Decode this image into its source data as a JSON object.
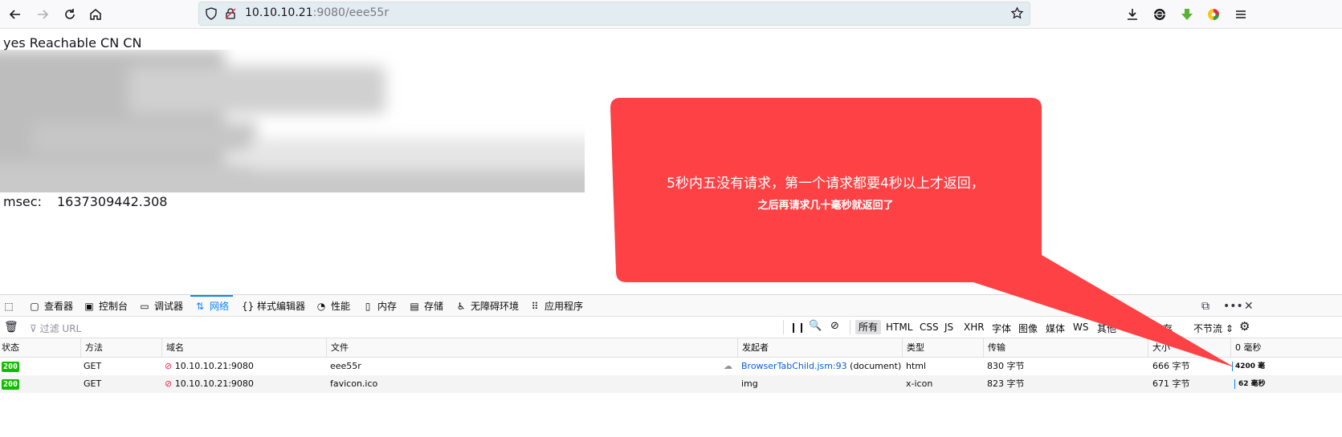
{
  "browser": {
    "url_host": "10.10.10.21",
    "url_rest": ":9080/eee55r"
  },
  "page": {
    "line1": "yes Reachable CN CN",
    "msec_label": "msec:",
    "msec_value": "1637309442.308"
  },
  "callout": {
    "line1": "5秒内五没有请求，第一个请求都要4秒以上才返回，",
    "line2": "之后再请求几十毫秒就返回了",
    "color": "#fe4145"
  },
  "devtools": {
    "tabs": [
      {
        "label": "查看器",
        "icon": "inspector-icon"
      },
      {
        "label": "控制台",
        "icon": "console-icon"
      },
      {
        "label": "调试器",
        "icon": "debugger-icon"
      },
      {
        "label": "网络",
        "icon": "network-icon"
      },
      {
        "label": "样式编辑器",
        "icon": "style-editor-icon"
      },
      {
        "label": "性能",
        "icon": "performance-icon"
      },
      {
        "label": "内存",
        "icon": "memory-icon"
      },
      {
        "label": "存储",
        "icon": "storage-icon"
      },
      {
        "label": "无障碍环境",
        "icon": "accessibility-icon"
      },
      {
        "label": "应用程序",
        "icon": "application-icon"
      }
    ],
    "active_tab": "网络",
    "filter_placeholder": "过滤 URL",
    "type_filters": [
      "所有",
      "HTML",
      "CSS",
      "JS",
      "XHR",
      "字体",
      "图像",
      "媒体",
      "WS",
      "其他"
    ],
    "selected_type": "所有",
    "partial_disable_cache": "存",
    "throttle_label": "不节流",
    "columns": [
      "状态",
      "方法",
      "域名",
      "文件",
      "发起者",
      "类型",
      "传输",
      "大小",
      "0 毫秒"
    ],
    "rows": [
      {
        "status": "200",
        "method": "GET",
        "domain": "10.10.10.21:9080",
        "file": "eee55r",
        "initiator_link": "BrowserTabChild.jsm:93",
        "initiator_rest": " (document)",
        "type": "html",
        "transferred": "830 字节",
        "size": "666 字节",
        "timing": "4200 毫"
      },
      {
        "status": "200",
        "method": "GET",
        "domain": "10.10.10.21:9080",
        "file": "favicon.ico",
        "initiator_link": "",
        "initiator_rest": "img",
        "type": "x-icon",
        "transferred": "823 字节",
        "size": "671 字节",
        "timing": "62 毫秒"
      }
    ]
  }
}
